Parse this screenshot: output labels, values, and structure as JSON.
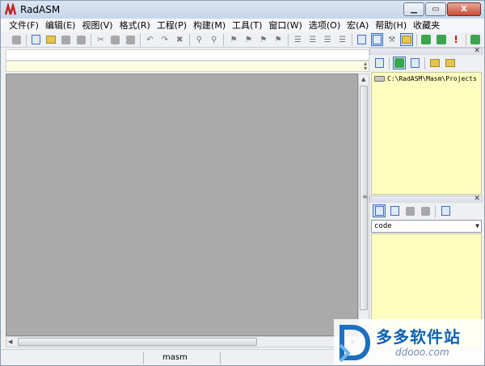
{
  "window": {
    "title": "RadASM",
    "close_symbol": "X"
  },
  "menubar": {
    "items": [
      "文件(F)",
      "编辑(E)",
      "视图(V)",
      "格式(R)",
      "工程(P)",
      "构建(M)",
      "工具(T)",
      "窗口(W)",
      "选项(O)",
      "宏(A)",
      "帮助(H)",
      "收藏夹"
    ]
  },
  "toolbar": {
    "icons": [
      "print-icon",
      "new-file-icon",
      "open-file-icon",
      "save-icon",
      "save-all-icon",
      "cut-icon",
      "copy-icon",
      "paste-icon",
      "undo-icon",
      "redo-icon",
      "delete-icon",
      "find-icon",
      "find-next-icon",
      "bookmark-icon",
      "bookmark-prev-icon",
      "bookmark-next-icon",
      "bookmark-clear-icon",
      "indent-icon",
      "outdent-icon",
      "comment-icon",
      "uncomment-icon",
      "project-browser-icon",
      "properties-icon",
      "tools-icon",
      "output-icon",
      "build-icon",
      "go-icon",
      "run-icon",
      "exit-icon"
    ]
  },
  "project_panel": {
    "path": "C:\\RadASM\\Masm\\Projects"
  },
  "properties_panel": {
    "selected": "code"
  },
  "statusbar": {
    "assembler": "masm"
  },
  "scrollbar": {
    "grip": "≡"
  },
  "watermark": {
    "title": "多多软件站",
    "url": "ddooo.com"
  },
  "colors": {
    "panel_bg": "#fdfdbf",
    "editor_bg": "#aaaaaa",
    "findbar_bg": "#fdfde0"
  }
}
